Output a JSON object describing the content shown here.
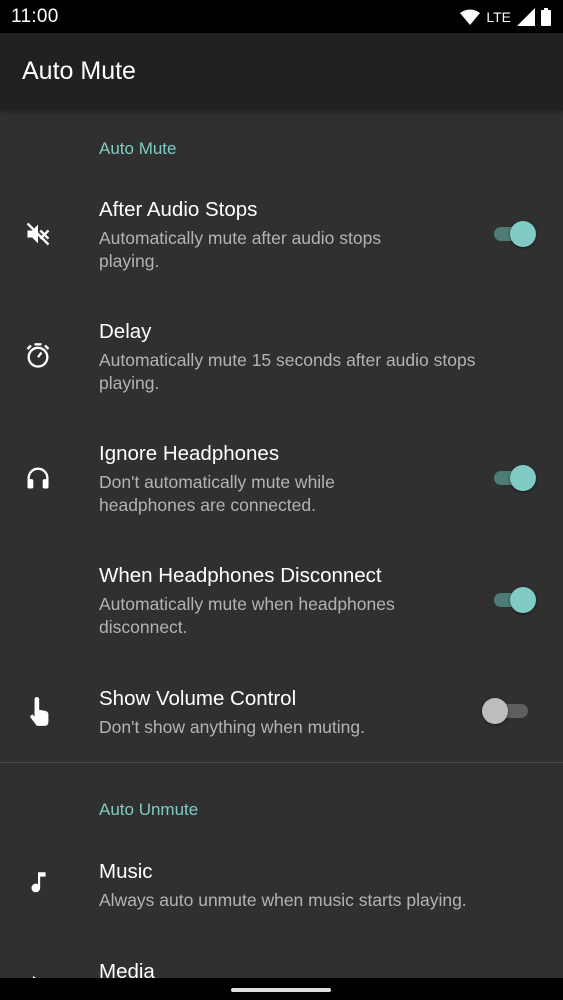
{
  "status": {
    "time": "11:00",
    "network": "LTE"
  },
  "app_bar": {
    "title": "Auto Mute"
  },
  "sections": {
    "auto_mute": {
      "header": "Auto Mute"
    },
    "auto_unmute": {
      "header": "Auto Unmute"
    }
  },
  "prefs": {
    "after_audio_stops": {
      "icon": "volume-off-icon",
      "title": "After Audio Stops",
      "summary": "Automatically mute after audio stops playing.",
      "enabled": true
    },
    "delay": {
      "icon": "timer-icon",
      "title": "Delay",
      "summary": "Automatically mute 15 seconds after audio stops playing."
    },
    "ignore_headphones": {
      "icon": "headphones-icon",
      "title": "Ignore Headphones",
      "summary": "Don't automatically mute while headphones are connected.",
      "enabled": true
    },
    "when_headphones_disconnect": {
      "title": "When Headphones Disconnect",
      "summary": "Automatically mute when headphones disconnect.",
      "enabled": true
    },
    "show_volume_control": {
      "icon": "touch-icon",
      "title": "Show Volume Control",
      "summary": "Don't show anything when muting.",
      "enabled": false
    },
    "music": {
      "icon": "music-note-icon",
      "title": "Music",
      "summary": "Always auto unmute when music starts playing."
    },
    "media": {
      "icon": "play-icon",
      "title": "Media"
    }
  },
  "colors": {
    "accent": "#80cbc4",
    "background": "#303030",
    "app_bar": "#212121"
  }
}
